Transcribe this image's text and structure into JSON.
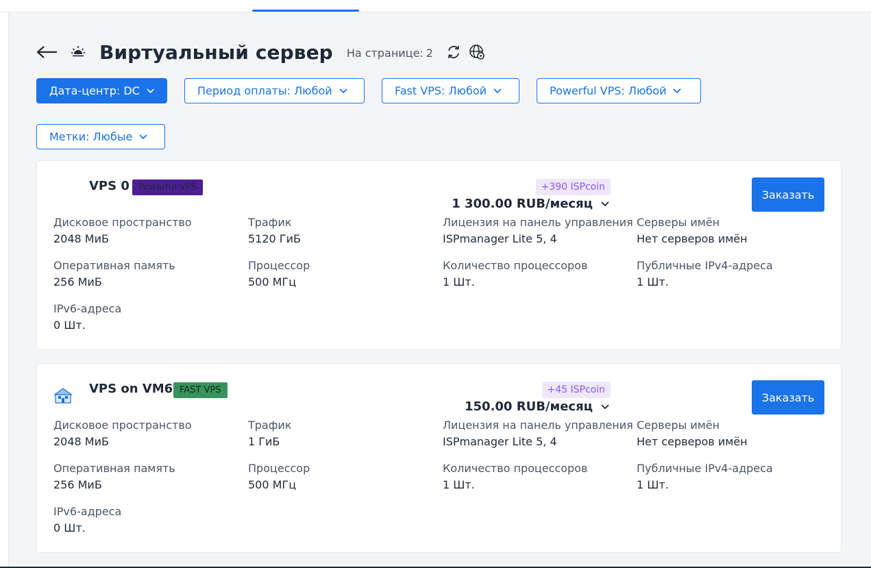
{
  "header": {
    "title": "Виртуальный сервер",
    "per_page_label": "На странице:",
    "per_page_value": "2"
  },
  "filters": [
    {
      "label": "Дата-центр: DC"
    },
    {
      "label": "Период оплаты: Любой"
    },
    {
      "label": "Fast VPS: Любой"
    },
    {
      "label": "Powerful VPS: Любой"
    },
    {
      "label": "Метки: Любые"
    }
  ],
  "order_label": "Заказать",
  "colors": {
    "accent": "#1a73e8",
    "badge_powerful": "#4c1d95",
    "badge_fast": "#38925c",
    "coin_bg": "#efe7fb",
    "coin_text": "#8b5cf6"
  },
  "products": [
    {
      "name": "VPS 0",
      "badge": "Powerful VPS",
      "coins": "+390 ISPcoin",
      "price": "1 300.00 RUB/месяц",
      "specs": {
        "disk": {
          "label": "Дисковое пространство",
          "value": "2048 МиБ"
        },
        "traffic": {
          "label": "Трафик",
          "value": "5120 ГиБ"
        },
        "license": {
          "label": "Лицензия на панель управления",
          "value": "ISPmanager Lite 5, 4"
        },
        "ns": {
          "label": "Серверы имён",
          "value": "Нет серверов имён"
        },
        "ram": {
          "label": "Оперативная память",
          "value": "256 МиБ"
        },
        "cpu": {
          "label": "Процессор",
          "value": "500 МГц"
        },
        "cpu_count": {
          "label": "Количество процессоров",
          "value": "1 Шт."
        },
        "ipv4": {
          "label": "Публичные IPv4-адреса",
          "value": "1 Шт."
        },
        "ipv6": {
          "label": "IPv6-адреса",
          "value": "0 Шт."
        }
      }
    },
    {
      "name": "VPS on VM6",
      "badge": "FAST VPS",
      "coins": "+45 ISPcoin",
      "price": "150.00 RUB/месяц",
      "specs": {
        "disk": {
          "label": "Дисковое пространство",
          "value": "2048 МиБ"
        },
        "traffic": {
          "label": "Трафик",
          "value": "1 ГиБ"
        },
        "license": {
          "label": "Лицензия на панель управления",
          "value": "ISPmanager Lite 5, 4"
        },
        "ns": {
          "label": "Серверы имён",
          "value": "Нет серверов имён"
        },
        "ram": {
          "label": "Оперативная память",
          "value": "256 МиБ"
        },
        "cpu": {
          "label": "Процессор",
          "value": "500 МГц"
        },
        "cpu_count": {
          "label": "Количество процессоров",
          "value": "1 Шт."
        },
        "ipv4": {
          "label": "Публичные IPv4-адреса",
          "value": "1 Шт."
        },
        "ipv6": {
          "label": "IPv6-адреса",
          "value": "0 Шт."
        }
      }
    }
  ]
}
